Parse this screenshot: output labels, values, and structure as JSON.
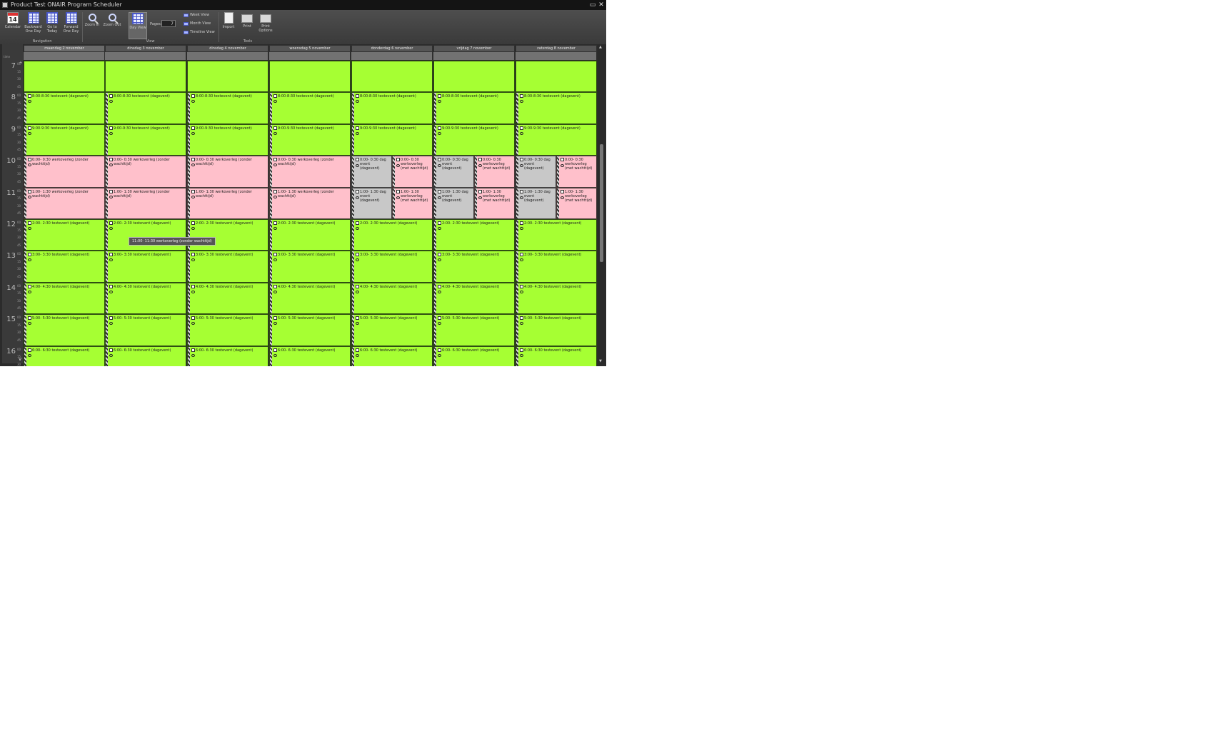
{
  "window": {
    "title": "Product Test ONAIR Program Scheduler",
    "maximize_glyph": "▭",
    "close_glyph": "✕"
  },
  "ribbon": {
    "calendar_day": "14",
    "buttons": {
      "calendar": "Calendar",
      "backward": "Backward One Day",
      "go_today": "Go to Today",
      "forward": "Forward One Day",
      "zoom_in": "Zoom In",
      "zoom_out": "Zoom Out",
      "day_view": "Day View",
      "import": "Import",
      "print": "Print",
      "print_options": "Print Options"
    },
    "pages_label": "Pages:",
    "pages_value": "7",
    "view_options": [
      "Week View",
      "Month View",
      "Timeline View"
    ],
    "groups": {
      "navigation": "Navigation",
      "view": "View",
      "tools": "Tools"
    }
  },
  "scheduler": {
    "corner_label": "time",
    "scroll_up": "^",
    "scroll_down": "v",
    "days": [
      "maandag 2 november",
      "dinsdag 3 november",
      "dinsdag 4 november",
      "woensdag 5 november",
      "donderdag 6 november",
      "vrijdag 7 november",
      "zaterdag 8 november"
    ],
    "selected_day_index": 0,
    "hours": [
      "7",
      "8",
      "9",
      "10",
      "11",
      "12",
      "13",
      "14",
      "15",
      "16"
    ],
    "minutes": [
      "00",
      "15",
      "30",
      "45"
    ],
    "appointments": {
      "h8": [
        "8:00-8:30 testevent (dagevent)",
        "8:00-8:30 testevent (dagevent)",
        "8:00-8:30 testevent (dagevent)",
        "8:00-8:30 testevent (dagevent)",
        "8:00-8:30 testevent (dagevent)",
        "8:00-8:30 testevent (dagevent)",
        "8:00-8:30 testevent (dagevent)"
      ],
      "h9": [
        "9:00-9:30 testevent (dagevent)",
        "9:00-9:30 testevent (dagevent)",
        "9:00-9:30 testevent (dagevent)",
        "9:00-9:30 testevent (dagevent)",
        "9:00-9:30 testevent (dagevent)",
        "9:00-9:30 testevent (dagevent)",
        "9:00-9:30 testevent (dagevent)"
      ],
      "h10_pink": [
        "0:00- 0:30 werkoverleg (zonder wachttijd)",
        "0:00- 0:30 werkoverleg (zonder wachttijd)",
        "0:00- 0:30 werkoverleg (zonder wachttijd)",
        "0:00- 0:30 werkoverleg (zonder wachttijd)"
      ],
      "h11_pink": [
        "1:00- 1:30 werkoverleg (zonder wachttijd)",
        "1:00- 1:30 werkoverleg (zonder wachttijd)",
        "1:00- 1:30 werkoverleg (zonder wachttijd)",
        "1:00- 1:30 werkoverleg (zonder wachttijd)"
      ],
      "h10_split": [
        {
          "gray": "0:00- 0:30 dag event (dagevent)",
          "pink": "0:00- 0:30 werkoverleg (met wachttijd)"
        },
        {
          "gray": "0:00- 0:30 dag event (dagevent)",
          "pink": "0:00- 0:30 werkoverleg (met wachttijd)"
        },
        {
          "gray": "0:00- 0:30 dag event (dagevent)",
          "pink": "0:00- 0:30 werkoverleg (met wachttijd)"
        }
      ],
      "h11_split": [
        {
          "gray": "1:00- 1:30 dag event (dagevent)",
          "pink": "1:00- 1:30 werkoverleg (met wachttijd)"
        },
        {
          "gray": "1:00- 1:30 dag event (dagevent)",
          "pink": "1:00- 1:30 werkoverleg (met wachttijd)"
        },
        {
          "gray": "1:00- 1:30 dag event (dagevent)",
          "pink": "1:00- 1:30 werkoverleg (met wachttijd)"
        }
      ],
      "h12": [
        "2:00- 2:30 testevent (dagevent)",
        "2:00- 2:30 testevent (dagevent)",
        "2:00- 2:30 testevent (dagevent)",
        "2:00- 2:30 testevent (dagevent)",
        "2:00- 2:30 testevent (dagevent)",
        "2:00- 2:30 testevent (dagevent)",
        "2:00- 2:30 testevent (dagevent)"
      ],
      "h13": [
        "3:00- 3:30 testevent (dagevent)",
        "3:00- 3:30 testevent (dagevent)",
        "3:00- 3:30 testevent (dagevent)",
        "3:00- 3:30 testevent (dagevent)",
        "3:00- 3:30 testevent (dagevent)",
        "3:00- 3:30 testevent (dagevent)",
        "3:00- 3:30 testevent (dagevent)"
      ],
      "h14": [
        "4:00- 4:30 testevent (dagevent)",
        "4:00- 4:30 testevent (dagevent)",
        "4:00- 4:30 testevent (dagevent)",
        "4:00- 4:30 testevent (dagevent)",
        "4:00- 4:30 testevent (dagevent)",
        "4:00- 4:30 testevent (dagevent)",
        "4:00- 4:30 testevent (dagevent)"
      ],
      "h15": [
        "5:00- 5:30 testevent (dagevent)",
        "5:00- 5:30 testevent (dagevent)",
        "5:00- 5:30 testevent (dagevent)",
        "5:00- 5:30 testevent (dagevent)",
        "5:00- 5:30 testevent (dagevent)",
        "5:00- 5:30 testevent (dagevent)",
        "5:00- 5:30 testevent (dagevent)"
      ],
      "h16": [
        "6:00- 6:30 testevent (dagevent)",
        "6:00- 6:30 testevent (dagevent)",
        "6:00- 6:30 testevent (dagevent)",
        "6:00- 6:30 testevent (dagevent)",
        "6:00- 6:30 testevent (dagevent)",
        "6:00- 6:30 testevent (dagevent)",
        "6:00- 6:30 testevent (dagevent)"
      ]
    },
    "tooltip": "11:00- 11:30 werkoverleg (zonder wachttijd)"
  },
  "colors": {
    "event_green": "#a6ff33",
    "event_pink": "#ffc0cb",
    "event_gray": "#c8c8c8",
    "app_background": "#1e1e1e"
  }
}
